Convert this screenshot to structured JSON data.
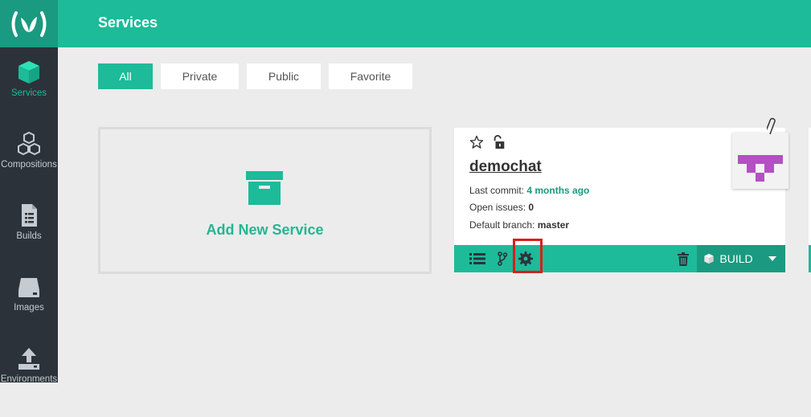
{
  "app": {
    "logo_text": "(ʋ)"
  },
  "sidebar": {
    "items": [
      {
        "label": "Services",
        "icon": "cube-icon"
      },
      {
        "label": "Compositions",
        "icon": "cubes-icon"
      },
      {
        "label": "Builds",
        "icon": "document-icon"
      },
      {
        "label": "Images",
        "icon": "drive-icon"
      },
      {
        "label": "Environments",
        "icon": "upload-icon"
      }
    ]
  },
  "header": {
    "title": "Services"
  },
  "filters": [
    {
      "label": "All",
      "active": true
    },
    {
      "label": "Private",
      "active": false
    },
    {
      "label": "Public",
      "active": false
    },
    {
      "label": "Favorite",
      "active": false
    }
  ],
  "add_card": {
    "label": "Add New Service",
    "icon": "archive-box-icon"
  },
  "service": {
    "name": "demochat",
    "last_commit_label": "Last commit: ",
    "last_commit_value": "4 months ago",
    "open_issues_label": "Open issues: ",
    "open_issues_value": "0",
    "default_branch_label": "Default branch: ",
    "default_branch_value": "master",
    "build_label": "BUILD"
  },
  "colors": {
    "accent": "#1dbb99",
    "accent_dark": "#1a9a80",
    "sidebar_bg": "#2c323a",
    "avatar_color": "#b44fc4",
    "highlight": "#d91e18"
  }
}
